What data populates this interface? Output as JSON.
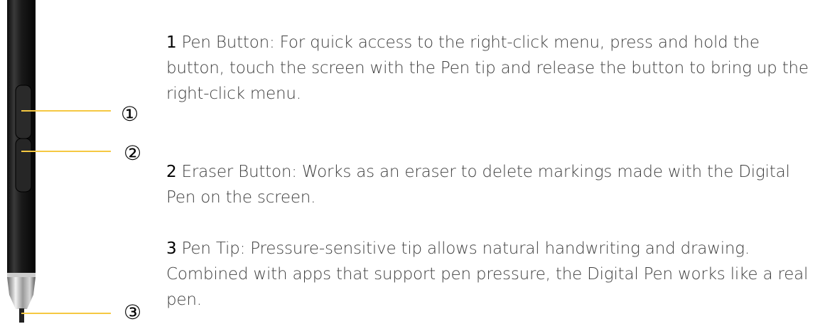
{
  "callouts": [
    {
      "marker": "①",
      "number": "1",
      "text": " Pen Button: For quick access to the right-click menu, press and hold the button, touch the screen with the Pen tip and release the button to bring up the right-click menu."
    },
    {
      "marker": "②",
      "number": "2",
      "text": " Eraser Button: Works as an eraser to delete markings made with the Digital Pen on the screen."
    },
    {
      "marker": "③",
      "number": "3",
      "text": " Pen Tip: Pressure-sensitive tip allows natural handwriting and drawing. Combined with apps that support pen pressure, the Digital Pen works like a real pen."
    }
  ],
  "colors": {
    "leader_line": "#f5c842",
    "pen_body": "#1a1a1a",
    "text": "#3f3f3f"
  }
}
